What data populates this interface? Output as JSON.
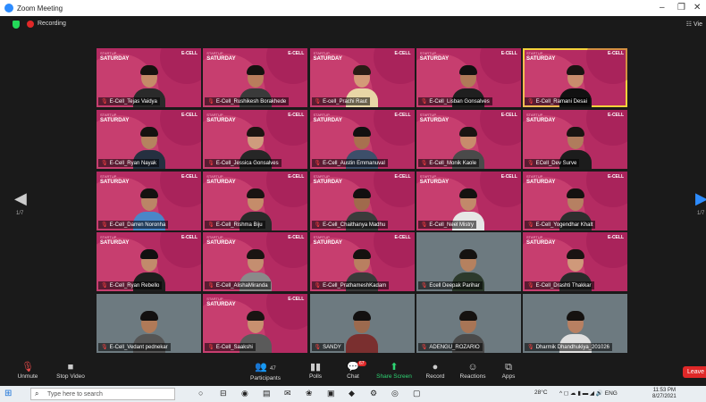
{
  "window": {
    "title": "Zoom Meeting",
    "minimize": "–",
    "restore": "❐",
    "close": "✕"
  },
  "status": {
    "recording": "Recording",
    "view": "☷ Vie"
  },
  "nav": {
    "left": "◀",
    "right": "▶",
    "left_page": "1/7",
    "right_page": "1/7"
  },
  "tiles": [
    {
      "name": "E-Cell_Tejas Vaidya",
      "bg": "pink",
      "head": "#c58b68",
      "hair": "#17120f",
      "shirt": "#2a2a2a"
    },
    {
      "name": "E-Cell_Rushikesh Borakhede",
      "bg": "pink",
      "head": "#b97d5c",
      "hair": "#151210",
      "shirt": "#3a3a3a"
    },
    {
      "name": "E-cell_Prachi Raut",
      "bg": "pink",
      "head": "#d49a78",
      "hair": "#2a1c15",
      "shirt": "#e8d7a6"
    },
    {
      "name": "E-Cell_Lisban Gonsalves",
      "bg": "pink",
      "head": "#b07a58",
      "hair": "#121010",
      "shirt": "#1f1f1f"
    },
    {
      "name": "E-Cell_Ramani Desai",
      "bg": "pink",
      "head": "#c98d6d",
      "hair": "#1a1412",
      "shirt": "#111111",
      "active": true
    },
    {
      "name": "E-Cell_Ryan Nayak",
      "bg": "pink",
      "head": "#b5835f",
      "hair": "#151210",
      "shirt": "#253040"
    },
    {
      "name": "E-Cell_Jessica Gonsalves",
      "bg": "pink",
      "head": "#cf9c7d",
      "hair": "#1d1512",
      "shirt": "#262626"
    },
    {
      "name": "E-Cell_Austin Emmanuval",
      "bg": "pink",
      "head": "#a8704f",
      "hair": "#121010",
      "shirt": "#3d4f6a"
    },
    {
      "name": "E-Cell_Monik Kaole",
      "bg": "pink",
      "head": "#c88c6c",
      "hair": "#1a1412",
      "shirt": "#4a4a4a"
    },
    {
      "name": "ECell_Dev Surve",
      "bg": "pink",
      "head": "#b07c5c",
      "hair": "#1a1412",
      "shirt": "#1c1c1c"
    },
    {
      "name": "E-Cell_Darren Noronha",
      "bg": "pink",
      "head": "#bb8566",
      "hair": "#151210",
      "shirt": "#4a86c8"
    },
    {
      "name": "E-Cell_Rishma Biju",
      "bg": "pink",
      "head": "#c58c6a",
      "hair": "#1a1412",
      "shirt": "#2a2a2a"
    },
    {
      "name": "E-Cell_Chaithanya Madhu",
      "bg": "pink",
      "head": "#a06a4c",
      "hair": "#121010",
      "shirt": "#3b3b3b"
    },
    {
      "name": "E-Cell_Neel Mistry",
      "bg": "pink",
      "head": "#c2896a",
      "hair": "#151210",
      "shirt": "#e6e6e6"
    },
    {
      "name": "E-Cell_Yogendhar Khalt",
      "bg": "pink",
      "head": "#b68062",
      "hair": "#151210",
      "shirt": "#2e2e2e"
    },
    {
      "name": "E-Cell_Ryan Rebello",
      "bg": "pink",
      "head": "#c28a6b",
      "hair": "#121010",
      "shirt": "#1e1e1e"
    },
    {
      "name": "E-Cell_AlishaMiranda",
      "bg": "pink",
      "head": "#c48e70",
      "hair": "#1a1412",
      "shirt": "#8a8a8a"
    },
    {
      "name": "E-Cell_PrathameshKadam",
      "bg": "pink",
      "head": "#b97f60",
      "hair": "#151210",
      "shirt": "#3a3a3a"
    },
    {
      "name": "Ecell Deepak Parihar",
      "bg": "cam",
      "head": "#b5815f",
      "hair": "#151210",
      "shirt": "#2c3a2c"
    },
    {
      "name": "E-Cell_Drashti Thakkar",
      "bg": "pink",
      "head": "#cf997a",
      "hair": "#1a1412",
      "shirt": "#2a2a2a"
    },
    {
      "name": "E-Cell_Vedant pednekar",
      "bg": "cam",
      "head": "#b07a58",
      "hair": "#121010",
      "shirt": "#555555"
    },
    {
      "name": "E-Cell_Saakshi",
      "bg": "pink",
      "head": "#c8906f",
      "hair": "#1a1412",
      "shirt": "#5a5a5a"
    },
    {
      "name": "SANDY",
      "bg": "cam",
      "head": "#9c6a4e",
      "hair": "#121010",
      "shirt": "#7a2f2f"
    },
    {
      "name": "ADENGU_ROZARIO",
      "bg": "cam",
      "head": "#a87556",
      "hair": "#151210",
      "shirt": "#4a4a4a"
    },
    {
      "name": "Dharmik Dhandhukiya_201026",
      "bg": "cam",
      "head": "#b88062",
      "hair": "#151210",
      "shirt": "#e0e0e0"
    }
  ],
  "tile_text": {
    "event_top": "STARTUP",
    "event_main": "SATURDAY",
    "ecell": "E-CELL",
    "mic_icon": "🎙"
  },
  "toolbar": {
    "unmute": "Unmute",
    "unmute_icon": "🎙",
    "stop_video": "Stop Video",
    "video_icon": "■",
    "participants": "Participants",
    "participants_icon": "👥",
    "participants_count": "47",
    "polls": "Polls",
    "polls_icon": "▮▮",
    "chat": "Chat",
    "chat_icon": "💬",
    "chat_badge": "67",
    "share": "Share Screen",
    "share_icon": "⬆",
    "record": "Record",
    "record_icon": "●",
    "reactions": "Reactions",
    "reactions_icon": "☺",
    "apps": "Apps",
    "apps_icon": "⧉",
    "leave": "Leave",
    "caret": "^"
  },
  "taskbar": {
    "win_icon": "⊞",
    "search_placeholder": "Type here to search",
    "search_icon": "⌕",
    "icons": [
      "○",
      "⊟",
      "◉",
      "▤",
      "✉",
      "❀",
      "▣",
      "◆",
      "⚙",
      "◎",
      "▢"
    ],
    "weather": "28°C",
    "tray": "^  ◻ ☁ ▮ ▬ ◢ 🔊 ENG",
    "time": "11:53 PM",
    "date": "8/27/2021"
  }
}
